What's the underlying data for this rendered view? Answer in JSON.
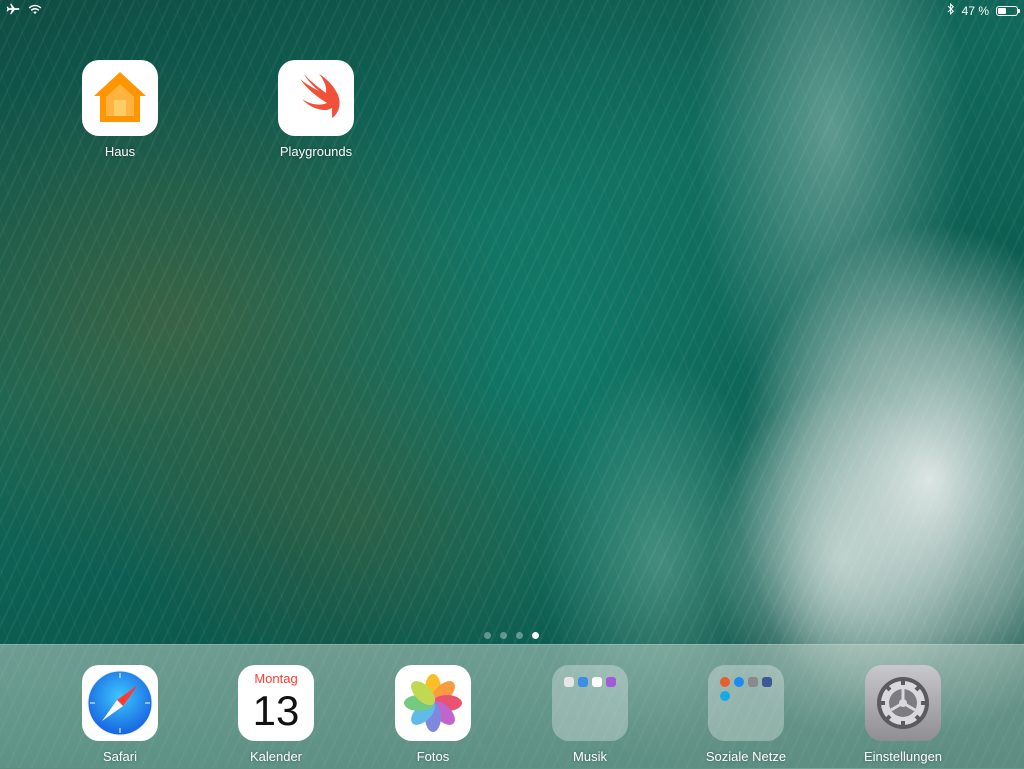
{
  "status_bar": {
    "airplane_icon": "airplane-icon",
    "wifi_icon": "wifi-icon",
    "bluetooth_icon": "bluetooth-icon",
    "battery_text": "47 %",
    "battery_level": 0.47
  },
  "home_apps": [
    {
      "label": "Haus",
      "icon": "home-icon"
    },
    {
      "label": "Playgrounds",
      "icon": "swift-icon"
    }
  ],
  "page_indicator": {
    "count": 4,
    "active_index": 3
  },
  "dock": [
    {
      "label": "Safari",
      "icon": "compass-icon"
    },
    {
      "label": "Kalender",
      "icon": "calendar-icon",
      "day_name": "Montag",
      "day_number": "13"
    },
    {
      "label": "Fotos",
      "icon": "photos-flower-icon"
    },
    {
      "label": "Musik",
      "icon": "folder-icon"
    },
    {
      "label": "Soziale Netze",
      "icon": "folder-icon"
    },
    {
      "label": "Einstellungen",
      "icon": "gear-icon"
    }
  ],
  "colors": {
    "calendar_red": "#ff3b30",
    "swift_orange": "#f05138",
    "home_orange": "#ff9500"
  }
}
